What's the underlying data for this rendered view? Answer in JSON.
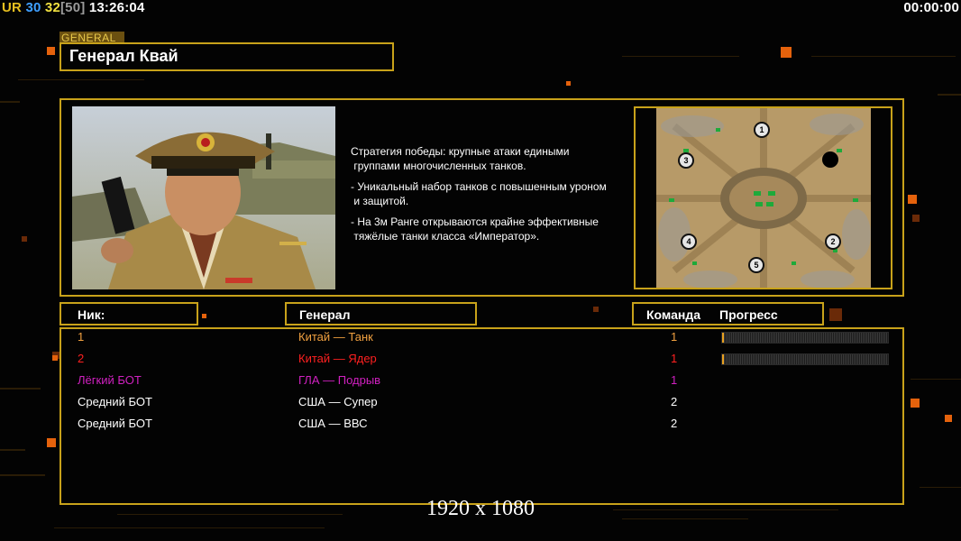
{
  "hud": {
    "left_segments": [
      {
        "text": "UR",
        "color": "#e8c020"
      },
      {
        "text": " 30",
        "color": "#3fa0ff"
      },
      {
        "text": " 32",
        "color": "#f0e040"
      },
      {
        "text": "[50]",
        "color": "#9a9a9a"
      },
      {
        "text": " 13:26:04",
        "color": "#ffffff"
      }
    ],
    "right_time": "00:00:00"
  },
  "general": {
    "tag": "GENERAL",
    "title": "Генерал Квай",
    "description": [
      "Стратегия победы: крупные атаки едиными\n группами многочисленных танков.",
      "- Уникальный набор танков с повышенным уроном\n и защитой.",
      "- На 3м Ранге открываются крайне эффективные\n тяжёлые танки класса «Император»."
    ]
  },
  "map": {
    "start_positions": [
      "1",
      "2",
      "3",
      "4",
      "5"
    ]
  },
  "table": {
    "headers": {
      "nick": "Ник:",
      "general": "Генерал",
      "team": "Команда",
      "progress": "Прогресс"
    },
    "rows": [
      {
        "nick": "1",
        "general": "Китай — Танк",
        "team": "1",
        "color": "#f0a040",
        "progress": 0.01
      },
      {
        "nick": "2",
        "general": "Китай — Ядер",
        "team": "1",
        "color": "#ff2020",
        "progress": 0.005
      },
      {
        "nick": "Лёгкий БОТ",
        "general": "ГЛА — Подрыв",
        "team": "1",
        "color": "#d020c0",
        "progress": null
      },
      {
        "nick": "Средний БОТ",
        "general": "США — Супер",
        "team": "2",
        "color": "#ffffff",
        "progress": null
      },
      {
        "nick": "Средний БОТ",
        "general": "США — ВВС",
        "team": "2",
        "color": "#ffffff",
        "progress": null
      }
    ]
  },
  "resolution_text": "1920 x 1080",
  "colors": {
    "frame": "#c8a21a",
    "accent_orange": "#e5620c"
  }
}
